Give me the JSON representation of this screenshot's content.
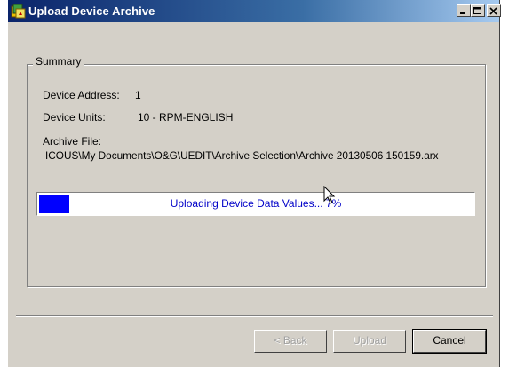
{
  "window": {
    "title": "Upload Device Archive"
  },
  "summary": {
    "group_label": "Summary",
    "device_address_label": "Device Address:",
    "device_address_value": "1",
    "device_units_label": "Device Units:",
    "device_units_value": "10 - RPM-ENGLISH",
    "archive_file_label": "Archive File:",
    "archive_file_value": "ICOUS\\My Documents\\O&G\\UEDIT\\Archive Selection\\Archive 20130506 150159.arx"
  },
  "progress": {
    "text": "Uploading Device Data Values... 7%",
    "percent": 7,
    "fill_color": "#0000ff"
  },
  "buttons": {
    "back": "< Back",
    "upload": "Upload",
    "cancel": "Cancel"
  },
  "icons": {
    "app": "upload-archive-icon",
    "minimize": "minimize-icon",
    "maximize": "maximize-icon",
    "close": "close-icon",
    "cursor": "mouse-pointer-icon"
  }
}
